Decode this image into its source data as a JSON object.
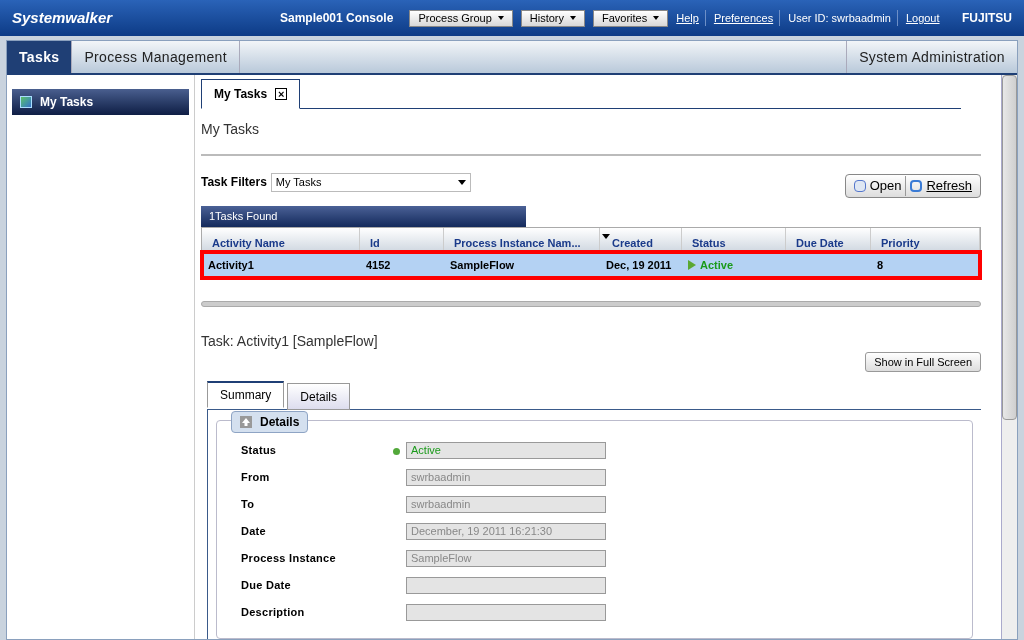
{
  "header": {
    "logo": "Systemwalker",
    "console": "Sample001 Console",
    "menus": [
      "Process Group",
      "History",
      "Favorites"
    ],
    "links": [
      "Help",
      "Preferences"
    ],
    "user": "User ID: swrbaadmin",
    "logout": "Logout",
    "brand": "FUJITSU"
  },
  "nav_tabs": [
    {
      "label": "Tasks",
      "selected": true
    },
    {
      "label": "Process Management",
      "selected": false
    }
  ],
  "nav_right": "System Administration",
  "sidebar": {
    "items": [
      {
        "label": "My Tasks",
        "selected": true
      }
    ]
  },
  "doc_tab": {
    "label": "My Tasks",
    "close": "×"
  },
  "page_title": "My Tasks",
  "filter": {
    "label": "Task Filters",
    "value": "My Tasks"
  },
  "actions": [
    "Open",
    "Refresh"
  ],
  "found": "1Tasks Found",
  "table": {
    "columns": [
      {
        "label": "Activity Name",
        "sorted": false
      },
      {
        "label": "Id",
        "sorted": false
      },
      {
        "label": "Process Instance Nam...",
        "sorted": false
      },
      {
        "label": "Created",
        "sorted": true
      },
      {
        "label": "Status",
        "sorted": false
      },
      {
        "label": "Due Date",
        "sorted": false
      },
      {
        "label": "Priority",
        "sorted": false
      }
    ],
    "rows": [
      {
        "selected": true,
        "cells": [
          "Activity1",
          "4152",
          "SampleFlow",
          "Dec, 19 2011",
          "Active",
          "",
          "8"
        ]
      }
    ]
  },
  "task_title": "Task: Activity1 [SampleFlow]",
  "fullscreen": "Show in Full Screen",
  "detail_tabs": [
    {
      "label": "Summary",
      "selected": true
    },
    {
      "label": "Details",
      "selected": false
    }
  ],
  "section": {
    "title": "Details",
    "expanded": true
  },
  "fields": [
    {
      "label": "Status",
      "value": "Active",
      "kind": "status"
    },
    {
      "label": "From",
      "value": "swrbaadmin",
      "kind": "text"
    },
    {
      "label": "To",
      "value": "swrbaadmin",
      "kind": "text"
    },
    {
      "label": "Date",
      "value": "December, 19 2011 16:21:30",
      "kind": "text"
    },
    {
      "label": "Process Instance",
      "value": "SampleFlow",
      "kind": "text"
    },
    {
      "label": "Due Date",
      "kind": "text"
    },
    {
      "label": "Description",
      "kind": "text"
    }
  ]
}
